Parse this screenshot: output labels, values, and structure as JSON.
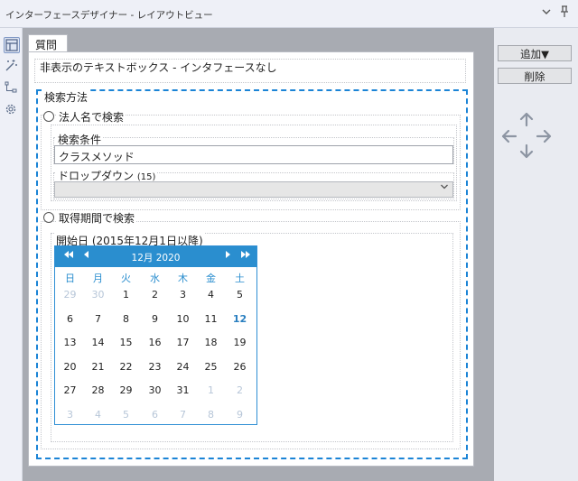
{
  "window": {
    "title": "インターフェースデザイナー - レイアウトビュー"
  },
  "tab": {
    "label": "質問"
  },
  "hidden_text": "非表示のテキストボックス - インタフェースなし",
  "search_group": {
    "title": "検索方法",
    "radio_corp": "法人名で検索",
    "condition_label": "検索条件",
    "condition_value": "クラスメソッド",
    "dropdown_label": "ドロップダウン",
    "dropdown_count": "(15)",
    "radio_period": "取得期間で検索",
    "start_label": "開始日 (2015年12月1日以降)"
  },
  "calendar": {
    "month_label": "12月 2020",
    "dow": [
      "日",
      "月",
      "火",
      "水",
      "木",
      "金",
      "土"
    ],
    "weeks": [
      [
        {
          "d": "29",
          "m": 1
        },
        {
          "d": "30",
          "m": 1
        },
        {
          "d": "1"
        },
        {
          "d": "2"
        },
        {
          "d": "3"
        },
        {
          "d": "4"
        },
        {
          "d": "5"
        }
      ],
      [
        {
          "d": "6"
        },
        {
          "d": "7"
        },
        {
          "d": "8"
        },
        {
          "d": "9"
        },
        {
          "d": "10"
        },
        {
          "d": "11"
        },
        {
          "d": "12",
          "t": 1
        }
      ],
      [
        {
          "d": "13"
        },
        {
          "d": "14"
        },
        {
          "d": "15"
        },
        {
          "d": "16"
        },
        {
          "d": "17"
        },
        {
          "d": "18"
        },
        {
          "d": "19"
        }
      ],
      [
        {
          "d": "20"
        },
        {
          "d": "21"
        },
        {
          "d": "22"
        },
        {
          "d": "23"
        },
        {
          "d": "24"
        },
        {
          "d": "25"
        },
        {
          "d": "26"
        }
      ],
      [
        {
          "d": "27"
        },
        {
          "d": "28"
        },
        {
          "d": "29"
        },
        {
          "d": "30"
        },
        {
          "d": "31"
        },
        {
          "d": "1",
          "m": 1
        },
        {
          "d": "2",
          "m": 1
        }
      ],
      [
        {
          "d": "3",
          "m": 1
        },
        {
          "d": "4",
          "m": 1
        },
        {
          "d": "5",
          "m": 1
        },
        {
          "d": "6",
          "m": 1
        },
        {
          "d": "7",
          "m": 1
        },
        {
          "d": "8",
          "m": 1
        },
        {
          "d": "9",
          "m": 1
        }
      ]
    ]
  },
  "right_panel": {
    "add_label": "追加▼",
    "delete_label": "削除"
  },
  "icons": {
    "chevron": "chevron-down-icon",
    "pin": "pin-icon",
    "layout": "layout-icon",
    "magic": "magic-wand-icon",
    "tree": "tree-icon",
    "gear": "gear-icon",
    "move": "move-arrows-icon"
  },
  "colors": {
    "accent": "#2a8ecf",
    "dashed": "#1b84d6"
  }
}
